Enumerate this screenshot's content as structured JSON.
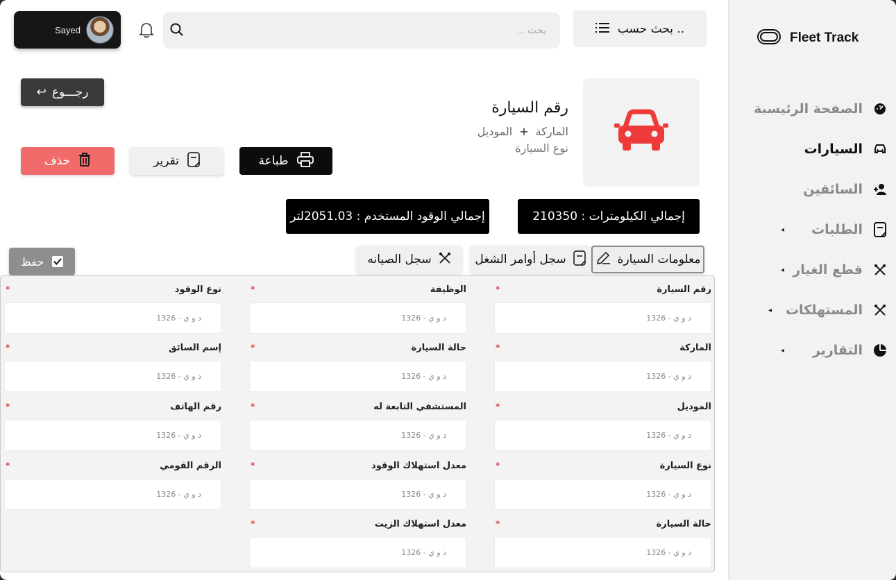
{
  "brand": {
    "name": "Fleet Track"
  },
  "user": {
    "name": "Sayed"
  },
  "search": {
    "placeholder": "بحث ...",
    "search_by_label": "بحث حسب .."
  },
  "sidebar": {
    "items": [
      {
        "label": "الصفحة الرئيسية",
        "icon": "dashboard-icon"
      },
      {
        "label": "السيارات",
        "icon": "car-icon"
      },
      {
        "label": "السائقين",
        "icon": "add-user-icon"
      },
      {
        "label": "الطلبات",
        "icon": "document-icon"
      },
      {
        "label": "قطع الغيار",
        "icon": "tools-icon"
      },
      {
        "label": "المستهلكات",
        "icon": "tools-icon"
      },
      {
        "label": "التقارير",
        "icon": "pie-chart-icon"
      }
    ]
  },
  "header": {
    "back_label": "رجـــوع",
    "car_number": "رقم السيارة",
    "brand": "الماركة",
    "model": "الموديل",
    "plus": "+",
    "car_type": "نوع السيارة",
    "print_label": "طباعة",
    "report_label": "تقرير",
    "delete_label": "حذف"
  },
  "stats": {
    "total_km": "إجمالي الكيلومترات : 210350",
    "total_fuel": "إجمالي الوقود المستخدم : 2051.03لتر"
  },
  "tabs": {
    "info": "معلومات السيارة",
    "orders": "سجل أوامر الشغل",
    "maintenance": "سجل الصيانه",
    "save": "حفظ"
  },
  "form": {
    "placeholder": "د و ي - 1326",
    "columns": [
      [
        "رقم السيارة",
        "الماركة",
        "الموديل",
        "نوع السيارة",
        "حالة السيارة"
      ],
      [
        "الوظيفة",
        "حالة السيارة",
        "المستشفي التابعة له",
        "معدل استهلاك الوقود",
        "معدل استهلاك الزيت"
      ],
      [
        "نوع الوقود",
        "إسم السائق",
        "رقم الهاتف",
        "الرقم القومي"
      ]
    ]
  },
  "colors": {
    "accent_red": "#ef3a3a",
    "delete_red": "#f16b6b"
  }
}
